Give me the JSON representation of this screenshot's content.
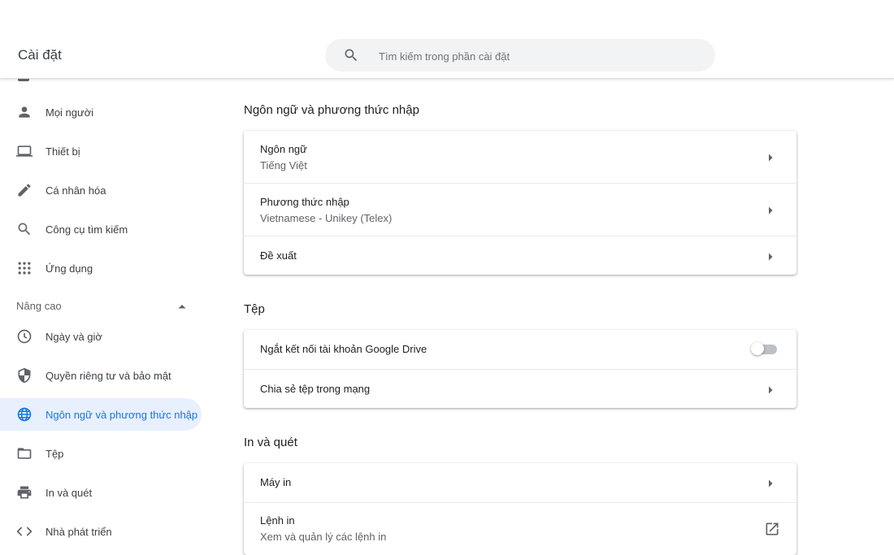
{
  "window": {
    "minimize_icon": "minimize-icon",
    "maximize_icon": "maximize-icon",
    "close_icon": "close-icon"
  },
  "header": {
    "title": "Cài đặt",
    "search": {
      "placeholder": "Tìm kiếm trong phần cài đặt",
      "value": "",
      "icon": "search-icon"
    }
  },
  "sidebar": {
    "items": [
      {
        "label": "Mọi người",
        "icon": "person-icon"
      },
      {
        "label": "Thiết bị",
        "icon": "laptop-icon"
      },
      {
        "label": "Cá nhân hóa",
        "icon": "brush-icon"
      },
      {
        "label": "Công cụ tìm kiếm",
        "icon": "search-icon"
      },
      {
        "label": "Ứng dụng",
        "icon": "apps-grid-icon"
      }
    ],
    "advanced": {
      "label": "Nâng cao",
      "icon": "chevron-up-icon",
      "items": [
        {
          "label": "Ngày và giờ",
          "icon": "clock-icon"
        },
        {
          "label": "Quyền riêng tư và bảo mật",
          "icon": "shield-icon"
        },
        {
          "label": "Ngôn ngữ và phương thức nhập",
          "icon": "globe-icon",
          "active": true
        },
        {
          "label": "Tệp",
          "icon": "folder-icon"
        },
        {
          "label": "In và quét",
          "icon": "printer-icon"
        },
        {
          "label": "Nhà phát triển",
          "icon": "code-icon"
        }
      ]
    }
  },
  "main": {
    "sections": [
      {
        "title": "Ngôn ngữ và phương thức nhập",
        "rows": [
          {
            "primary": "Ngôn ngữ",
            "secondary": "Tiếng Việt",
            "control": "arrow"
          },
          {
            "primary": "Phương thức nhập",
            "secondary": "Vietnamese - Unikey (Telex)",
            "control": "arrow"
          },
          {
            "primary": "Đề xuất",
            "control": "arrow"
          }
        ]
      },
      {
        "title": "Tệp",
        "rows": [
          {
            "primary": "Ngắt kết nối tài khoản Google Drive",
            "control": "toggle",
            "toggle_on": false
          },
          {
            "primary": "Chia sẻ tệp trong mạng",
            "control": "arrow"
          }
        ]
      },
      {
        "title": "In và quét",
        "rows": [
          {
            "primary": "Máy in",
            "control": "arrow"
          },
          {
            "primary": "Lệnh in",
            "secondary": "Xem và quản lý các lệnh in",
            "control": "open-in-new"
          }
        ]
      }
    ]
  },
  "colors": {
    "accent": "#1a73e8",
    "active_bg": "#e8f0fe",
    "icon": "#5f6368",
    "toggle_off": "#bdc1c6"
  }
}
